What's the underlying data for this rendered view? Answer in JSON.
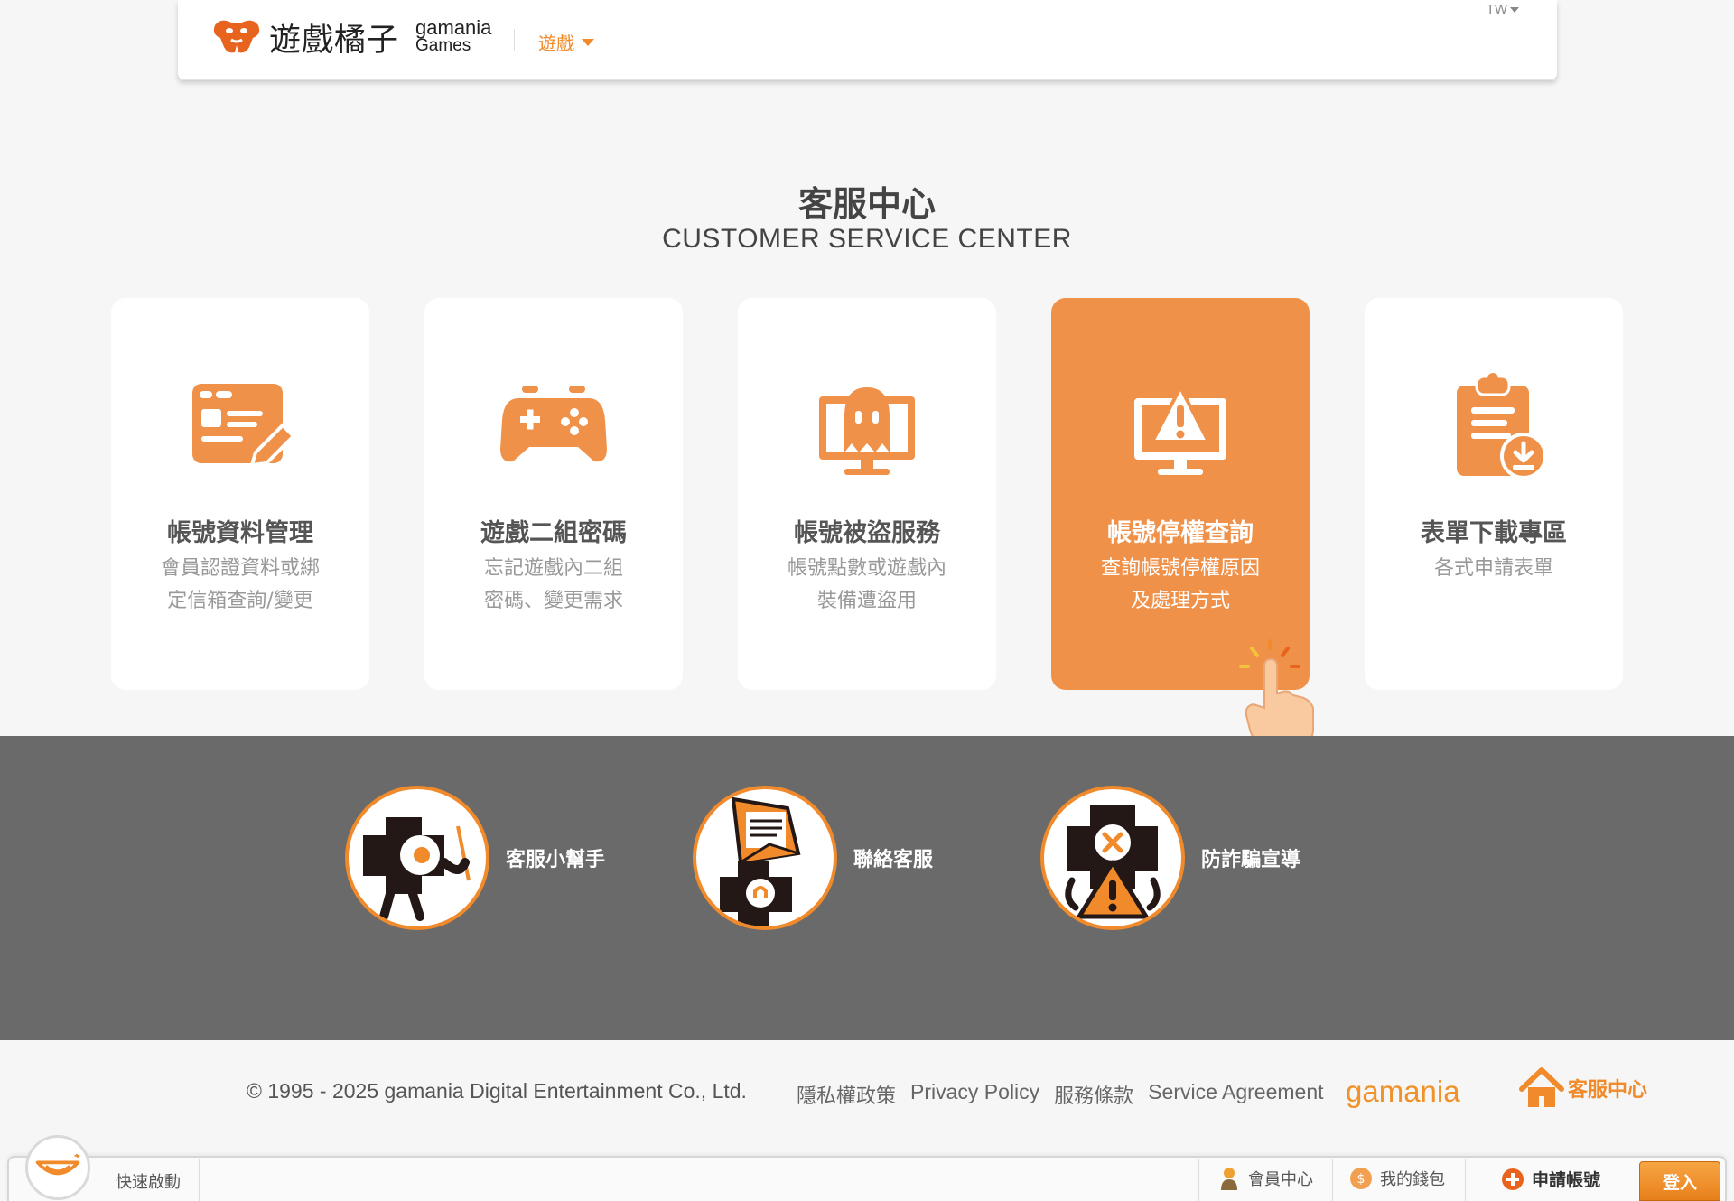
{
  "header": {
    "logo_cn": "遊戲橘子",
    "logo_en_line1": "gamania",
    "logo_en_line2": "Games",
    "nav_games": "遊戲",
    "lang": "TW"
  },
  "page": {
    "title_cn": "客服中心",
    "title_en": "CUSTOMER SERVICE CENTER"
  },
  "cards": [
    {
      "icon": "account-edit-icon",
      "title": "帳號資料管理",
      "desc_line1": "會員認證資料或綁",
      "desc_line2": "定信箱查詢/變更"
    },
    {
      "icon": "gamepad-icon",
      "title": "遊戲二組密碼",
      "desc_line1": "忘記遊戲內二組",
      "desc_line2": "密碼、變更需求"
    },
    {
      "icon": "ghost-monitor-icon",
      "title": "帳號被盜服務",
      "desc_line1": "帳號點數或遊戲內",
      "desc_line2": "裝備遭盜用"
    },
    {
      "icon": "alert-monitor-icon",
      "title": "帳號停權查詢",
      "desc_line1": "查詢帳號停權原因",
      "desc_line2": "及處理方式"
    },
    {
      "icon": "clipboard-download-icon",
      "title": "表單下載專區",
      "desc_line1": "各式申請表單",
      "desc_line2": ""
    }
  ],
  "helpers": [
    {
      "label": "客服小幫手",
      "icon": "mascot-pointer-icon"
    },
    {
      "label": "聯絡客服",
      "icon": "mascot-mail-icon"
    },
    {
      "label": "防詐騙宣導",
      "icon": "mascot-warning-icon"
    }
  ],
  "footer": {
    "copyright": "© 1995 - 2025 gamania Digital Entertainment Co., Ltd.",
    "privacy_cn": "隱私權政策",
    "privacy_en": "Privacy Policy",
    "terms_cn": "服務條款",
    "terms_en": "Service Agreement",
    "brand": "gamania",
    "cs_link": "客服中心"
  },
  "toolbar": {
    "quick_start": "快速啟動",
    "member_center": "會員中心",
    "wallet": "我的錢包",
    "apply_account": "申請帳號",
    "login": "登入"
  },
  "colors": {
    "accent": "#f08a2a",
    "active_card": "#f0914a",
    "band": "#6a6a6a"
  }
}
